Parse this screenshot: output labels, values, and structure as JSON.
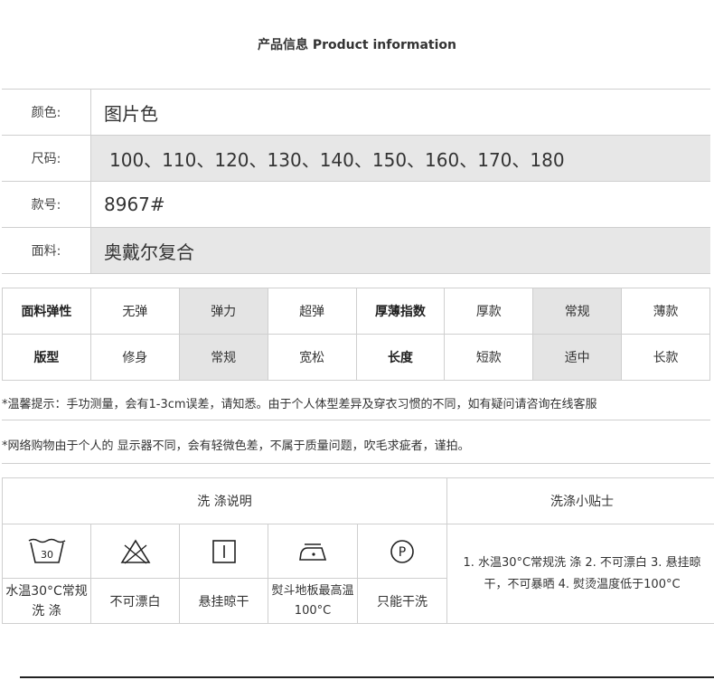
{
  "title": "产品信息 Product information",
  "info": {
    "color_label": "颜色:",
    "color_value": "图片色",
    "size_label": "尺码:",
    "size_value": "100、110、120、130、140、150、160、170、180",
    "style_no_label": "款号:",
    "style_no_value": "8967#",
    "fabric_label": "面料:",
    "fabric_value": "奥戴尔复合"
  },
  "spec": {
    "elasticity_label": "面料弹性",
    "elasticity_options": [
      "无弹",
      "弹力",
      "超弹"
    ],
    "elasticity_selected": "弹力",
    "thickness_label": "厚薄指数",
    "thickness_options": [
      "厚款",
      "常规",
      "薄款"
    ],
    "thickness_selected": "常规",
    "fit_label": "版型",
    "fit_options": [
      "修身",
      "常规",
      "宽松"
    ],
    "fit_selected": "常规",
    "length_label": "长度",
    "length_options": [
      "短款",
      "适中",
      "长款"
    ],
    "length_selected": "适中"
  },
  "notes": {
    "measure": "*温馨提示：手功测量，会有1-3cm误差，请知悉。由于个人体型差异及穿衣习惯的不同，如有疑问请咨询在线客服",
    "color_diff": "*网络购物由于个人的 显示器不同，会有轻微色差，不属于质量问题，吹毛求疵者，谨拍。"
  },
  "wash": {
    "header": "洗 涤说明",
    "tips_header": "洗涤小贴士",
    "icons": [
      {
        "icon": "wash-30-icon",
        "number": "30",
        "line1": "水温30°C常规",
        "line2": "洗 涤"
      },
      {
        "icon": "no-bleach-icon",
        "line1": "不可漂白",
        "line2": ""
      },
      {
        "icon": "hang-dry-icon",
        "line1": "悬挂晾干",
        "line2": ""
      },
      {
        "icon": "iron-icon",
        "line1": "熨斗地板最高温",
        "line2": "100°C"
      },
      {
        "icon": "dry-clean-icon",
        "letter": "P",
        "line1": "只能干洗",
        "line2": ""
      }
    ],
    "tips_line1": "1. 水温30°C常规洗 涤 2. 不可漂白 3. 悬挂晾",
    "tips_line2": "干，不可暴晒 4. 熨烫温度低于100°C"
  }
}
